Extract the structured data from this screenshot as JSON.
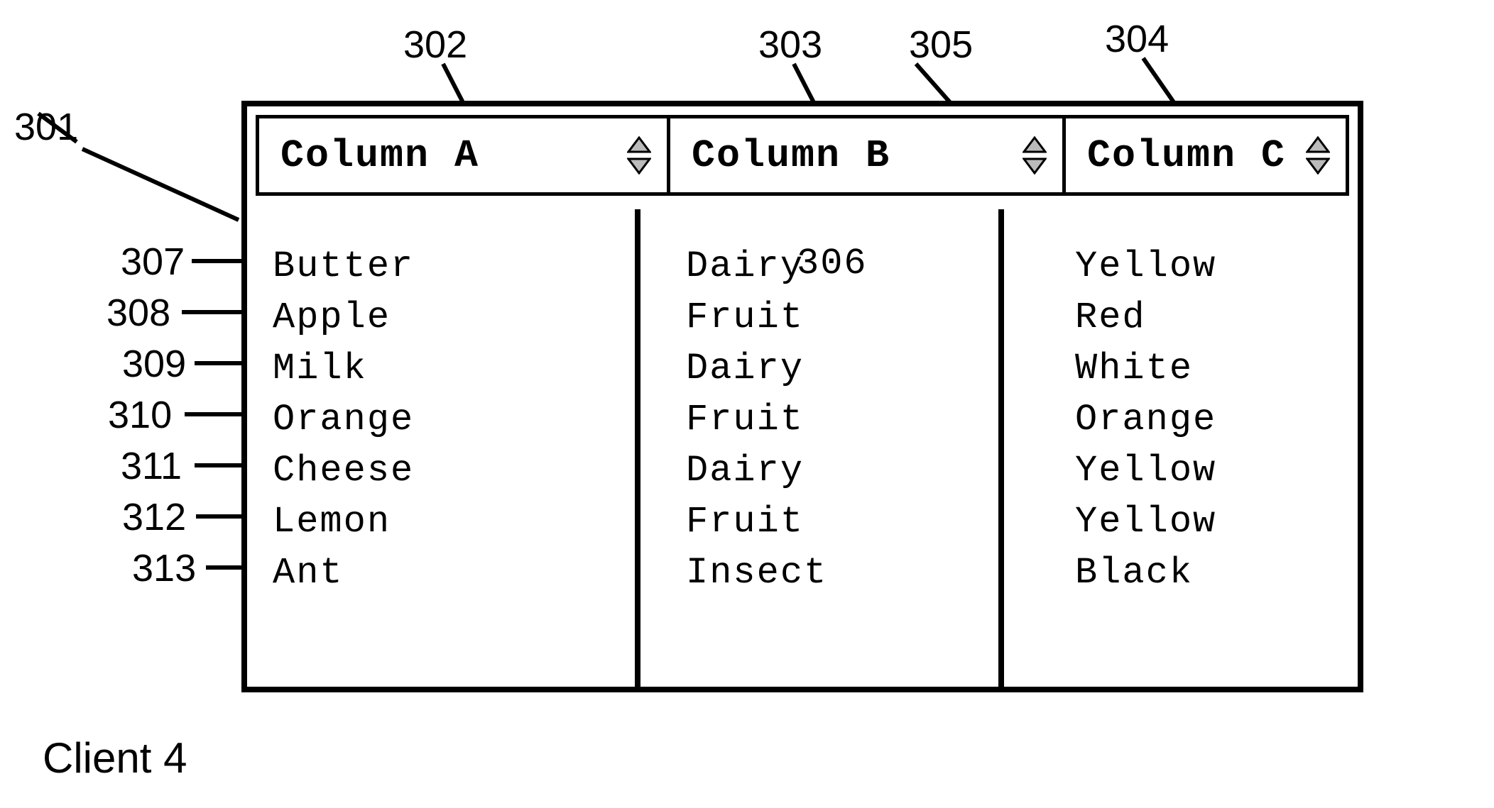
{
  "table": {
    "columns": [
      {
        "label": "Column A"
      },
      {
        "label": "Column B"
      },
      {
        "label": "Column C"
      }
    ],
    "rows": [
      {
        "a": "Butter",
        "b": "Dairy",
        "c": "Yellow"
      },
      {
        "a": "Apple",
        "b": "Fruit",
        "c": "Red"
      },
      {
        "a": "Milk",
        "b": "Dairy",
        "c": "White"
      },
      {
        "a": "Orange",
        "b": "Fruit",
        "c": "Orange"
      },
      {
        "a": "Cheese",
        "b": "Dairy",
        "c": "Yellow"
      },
      {
        "a": "Lemon",
        "b": "Fruit",
        "c": "Yellow"
      },
      {
        "a": "Ant",
        "b": "Insect",
        "c": "Black"
      }
    ]
  },
  "refs": {
    "r301": "301",
    "r302": "302",
    "r303": "303",
    "r304": "304",
    "r305": "305",
    "r306": "306",
    "r307": "307",
    "r308": "308",
    "r309": "309",
    "r310": "310",
    "r311": "311",
    "r312": "312",
    "r313": "313"
  },
  "footer": "Client 4"
}
